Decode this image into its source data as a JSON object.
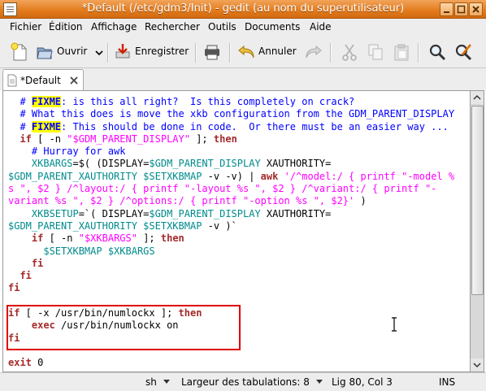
{
  "window": {
    "title": "*Default (/etc/gdm3/Init) - gedit (au nom du superutilisateur)"
  },
  "menu": [
    "Fichier",
    "Édition",
    "Affichage",
    "Rechercher",
    "Outils",
    "Documents",
    "Aide"
  ],
  "toolbar": {
    "open_label": "Ouvrir",
    "save_label": "Enregistrer",
    "undo_label": "Annuler"
  },
  "tab": {
    "label": "*Default"
  },
  "code_lines": [
    [
      {
        "t": "  # ",
        "c": "c"
      },
      {
        "t": "FIXME",
        "c": "fix"
      },
      {
        "t": ": is this all right?  Is this completely on crack?",
        "c": "c"
      }
    ],
    [
      {
        "t": "  # What this does is move the xkb configuration from the GDM_PARENT_DISPLAY",
        "c": "c"
      }
    ],
    [
      {
        "t": "  # ",
        "c": "c"
      },
      {
        "t": "FIXME",
        "c": "fix"
      },
      {
        "t": ": This should be done in code.  Or there must be an easier way ...",
        "c": "c"
      }
    ],
    [
      {
        "t": "  if",
        "c": "k"
      },
      {
        "t": " [ -n ",
        "c": ""
      },
      {
        "t": "\"$GDM_PARENT_DISPLAY\"",
        "c": "s"
      },
      {
        "t": " ]; ",
        "c": ""
      },
      {
        "t": "then",
        "c": "k"
      }
    ],
    [
      {
        "t": "    # Hurray for awk",
        "c": "c"
      }
    ],
    [
      {
        "t": "    XKBARGS",
        "c": "v"
      },
      {
        "t": "=$( (DISPLAY=",
        "c": ""
      },
      {
        "t": "$GDM_PARENT_DISPLAY",
        "c": "v"
      },
      {
        "t": " XAUTHORITY=",
        "c": ""
      }
    ],
    [
      {
        "t": "$GDM_PARENT_XAUTHORITY $SETXKBMAP",
        "c": "v"
      },
      {
        "t": " -v -v) | ",
        "c": ""
      },
      {
        "t": "awk",
        "c": "k"
      },
      {
        "t": " '/^model:/ { printf \"-model %",
        "c": "s"
      }
    ],
    [
      {
        "t": "s \", $2 } /^layout:/ { printf \"-layout %s \", $2 } /^variant:/ { printf \"-",
        "c": "s"
      }
    ],
    [
      {
        "t": "variant %s \", $2 } /^options:/ { printf \"-option %s \", $2}'",
        "c": "s"
      },
      {
        "t": " )",
        "c": ""
      }
    ],
    [
      {
        "t": "    XKBSETUP",
        "c": "v"
      },
      {
        "t": "=`( DISPLAY=",
        "c": ""
      },
      {
        "t": "$GDM_PARENT_DISPLAY",
        "c": "v"
      },
      {
        "t": " XAUTHORITY=",
        "c": ""
      }
    ],
    [
      {
        "t": "$GDM_PARENT_XAUTHORITY $SETXKBMAP",
        "c": "v"
      },
      {
        "t": " -v )`",
        "c": ""
      }
    ],
    [
      {
        "t": "    if",
        "c": "k"
      },
      {
        "t": " [ -n ",
        "c": ""
      },
      {
        "t": "\"$XKBARGS\"",
        "c": "s"
      },
      {
        "t": " ]; ",
        "c": ""
      },
      {
        "t": "then",
        "c": "k"
      }
    ],
    [
      {
        "t": "      $SETXKBMAP $XKBARGS",
        "c": "v"
      }
    ],
    [
      {
        "t": "    fi",
        "c": "k"
      }
    ],
    [
      {
        "t": "  fi",
        "c": "k"
      }
    ],
    [
      {
        "t": "fi",
        "c": "k"
      }
    ],
    [],
    [
      {
        "t": "if",
        "c": "k"
      },
      {
        "t": " [ -x /usr/bin/numlockx ]; ",
        "c": ""
      },
      {
        "t": "then",
        "c": "k"
      }
    ],
    [
      {
        "t": "    exec",
        "c": "k"
      },
      {
        "t": " /usr/bin/numlockx on",
        "c": ""
      }
    ],
    [
      {
        "t": "fi",
        "c": "k"
      }
    ],
    [],
    [
      {
        "t": "exit",
        "c": "k"
      },
      {
        "t": " 0",
        "c": ""
      }
    ]
  ],
  "status": {
    "language": "sh",
    "tab_width": "Largeur des tabulations: 8",
    "position": "Lig 80, Col 3",
    "mode": "INS"
  },
  "colors": {
    "titlebar": "#e27a1c",
    "highlight_box": "#e00000"
  }
}
